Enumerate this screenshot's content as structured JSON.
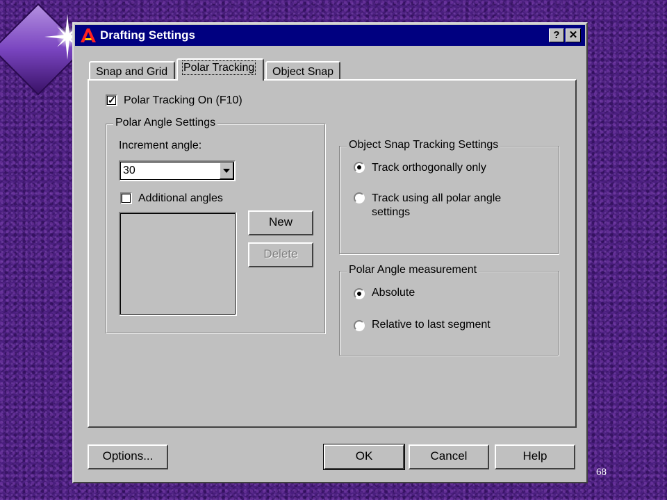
{
  "slide": {
    "number": "68"
  },
  "window": {
    "title": "Drafting Settings",
    "help_button": "?",
    "close_button": "✕"
  },
  "tabs": [
    {
      "label": "Snap and Grid"
    },
    {
      "label": "Polar Tracking",
      "active": true
    },
    {
      "label": "Object Snap"
    }
  ],
  "polar_tracking": {
    "on_label": "Polar Tracking On (F10)",
    "on_checked": true
  },
  "polar_angle_settings": {
    "title": "Polar Angle Settings",
    "increment_label": "Increment angle:",
    "increment_value": "30",
    "additional_label": "Additional angles",
    "additional_checked": false,
    "new_button": "New",
    "delete_button": "Delete"
  },
  "object_snap_tracking": {
    "title": "Object Snap Tracking Settings",
    "option_ortho": "Track orthogonally only",
    "option_polar_line1": "Track using all polar angle",
    "option_polar_line2": "settings",
    "selected": "ortho"
  },
  "polar_angle_measurement": {
    "title": "Polar Angle measurement",
    "option_absolute": "Absolute",
    "option_relative": "Relative to last segment",
    "selected": "absolute"
  },
  "footer": {
    "options_button": "Options...",
    "ok_button": "OK",
    "cancel_button": "Cancel",
    "help_button": "Help"
  }
}
